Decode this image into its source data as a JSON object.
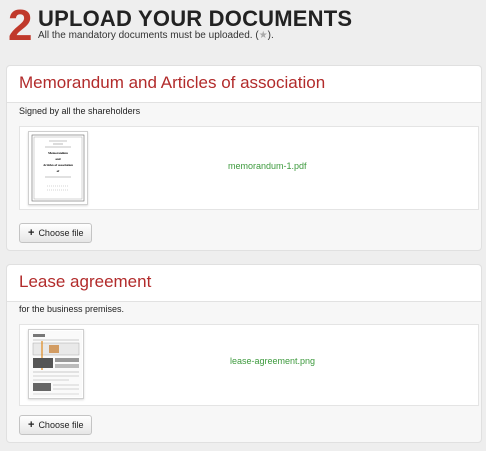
{
  "step": {
    "number": "2",
    "title": "UPLOAD YOUR DOCUMENTS",
    "subtitle_before": "All the mandatory documents must be uploaded. (",
    "subtitle_after": ")."
  },
  "documents": [
    {
      "title": "Memorandum and Articles of association",
      "description": "Signed by all the shareholders",
      "file_name": "memorandum-1.pdf",
      "button_label": "Choose file",
      "thumbnail_text": [
        "Memorandum",
        "and",
        "Articles of association",
        "of"
      ]
    },
    {
      "title": "Lease agreement",
      "description": "for the business premises.",
      "file_name": "lease-agreement.png",
      "button_label": "Choose file"
    }
  ],
  "colors": {
    "accent": "#c0392b",
    "file_link": "#3d9a3d"
  }
}
